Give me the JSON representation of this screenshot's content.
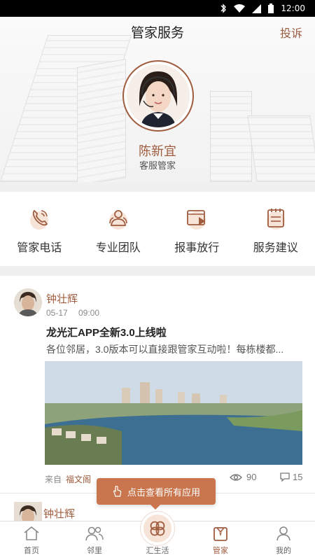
{
  "status_bar": {
    "time": "12:00"
  },
  "header": {
    "title": "管家服务",
    "complain_label": "投诉",
    "butler_name": "陈新宜",
    "butler_role": "客服管家"
  },
  "services": [
    {
      "label": "管家电话",
      "icon": "phone-icon"
    },
    {
      "label": "专业团队",
      "icon": "team-icon"
    },
    {
      "label": "报事放行",
      "icon": "video-release-icon"
    },
    {
      "label": "服务建议",
      "icon": "suggestion-notepad-icon"
    }
  ],
  "post": {
    "author": "钟壮辉",
    "date": "05-17",
    "time": "09:00",
    "title": "龙光汇APP全新3.0上线啦",
    "excerpt": "各位邻居，3.0版本可以直接跟管家互动啦！每栋楼都...",
    "from_prefix": "来自",
    "from_name": "福文阁",
    "views": "90",
    "comments": "15"
  },
  "post2": {
    "author": "钟壮辉"
  },
  "tooltip": {
    "label": "点击查看所有应用"
  },
  "tabbar": {
    "items": [
      {
        "label": "首页",
        "icon": "home-icon"
      },
      {
        "label": "邻里",
        "icon": "neighbors-icon"
      },
      {
        "label": "汇生活",
        "icon": "clover-icon"
      },
      {
        "label": "管家",
        "icon": "butler-icon"
      },
      {
        "label": "我的",
        "icon": "profile-icon"
      }
    ],
    "active_index": 3
  },
  "colors": {
    "accent": "#a05c3e",
    "tooltip": "#c9764f",
    "divider": "#f0f0f0"
  }
}
